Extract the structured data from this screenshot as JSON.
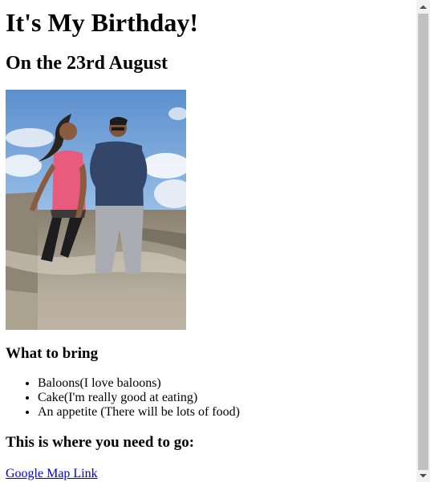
{
  "page": {
    "title": "It's My Birthday!",
    "subtitle": "On the 23rd August",
    "photo_alt": "Two people standing in shallow water at a beach"
  },
  "bring": {
    "heading": "What to bring",
    "items": [
      "Baloons(I love baloons)",
      "Cake(I'm really good at eating)",
      "An appetite (There will be lots of food)"
    ]
  },
  "directions": {
    "heading": "This is where you need to go:",
    "link_text": "Google Map Link"
  },
  "icons": {
    "scroll_up": "scroll-up-arrow-icon",
    "scroll_down": "scroll-down-arrow-icon"
  }
}
